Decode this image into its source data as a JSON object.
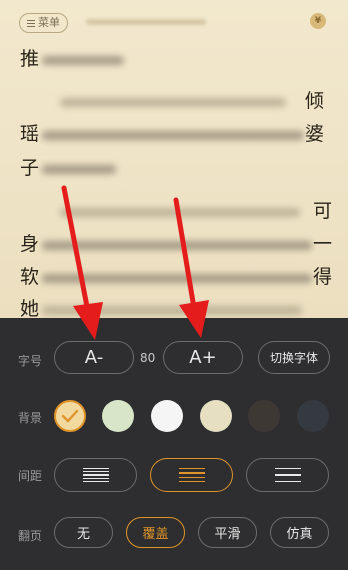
{
  "reader": {
    "menu_label": "菜单",
    "text_chars": {
      "tui": "推",
      "qing": "倾",
      "yao": "瑶",
      "po": "婆",
      "zi": "子",
      "ke": "可",
      "shen": "身",
      "yi": "一",
      "ruan": "软",
      "de": "得",
      "ta": "她"
    }
  },
  "settings": {
    "font_size": {
      "label": "字号",
      "decrease": "A-",
      "value": "80",
      "increase": "A+",
      "switch_font": "切换字体"
    },
    "background": {
      "label": "背景",
      "options": [
        {
          "color": "#f1d9a0",
          "selected": true
        },
        {
          "color": "#d9e5c8",
          "selected": false
        },
        {
          "color": "#f5f5f5",
          "selected": false
        },
        {
          "color": "#e6dfc2",
          "selected": false
        },
        {
          "color": "#3e3835",
          "selected": false
        },
        {
          "color": "#353a40",
          "selected": false
        }
      ]
    },
    "spacing": {
      "label": "间距",
      "options": [
        "compact",
        "medium",
        "loose"
      ],
      "selected": "medium"
    },
    "page_turn": {
      "label": "翻页",
      "options": [
        "无",
        "覆盖",
        "平滑",
        "仿真"
      ],
      "selected": "覆盖"
    }
  },
  "colors": {
    "accent": "#e0942a",
    "panel_bg": "#2e2e30",
    "arrow": "#e41c1c"
  }
}
